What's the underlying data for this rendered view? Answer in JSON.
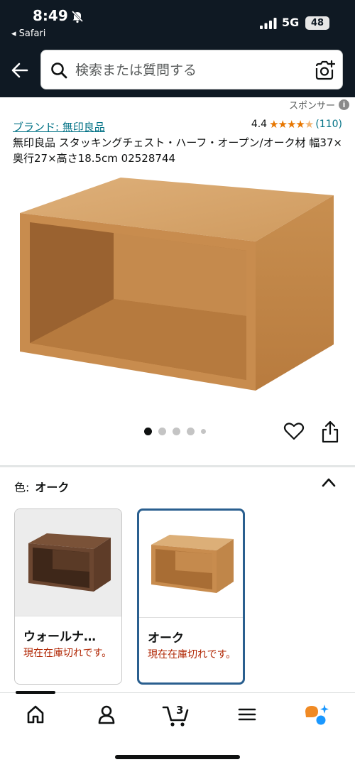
{
  "status_bar": {
    "time": "8:49",
    "back_app": "◂ Safari",
    "network": "5G",
    "battery": "48"
  },
  "header": {
    "search_placeholder": "検索または質問する"
  },
  "sponsored": "スポンサー",
  "product": {
    "brand_link": "ブランド: 無印良品",
    "rating": "4.4",
    "rating_value": 4.4,
    "review_count": "(110)",
    "title": "無印良品 スタッキングチェスト・ハーフ・オープン/オーク材 幅37×奥行27×高さ18.5cm 02528744"
  },
  "gallery": {
    "image_count": 5,
    "active_index": 0
  },
  "variants": {
    "label": "色:",
    "selected": "オーク",
    "options": [
      {
        "name": "ウォールナ…",
        "stock": "現在在庫切れです。",
        "finish": "walnut"
      },
      {
        "name": "オーク",
        "stock": "現在在庫切れです。",
        "finish": "oak"
      }
    ]
  },
  "tabbar": {
    "cart_count": "3"
  },
  "colors": {
    "header_bg": "#0f1923",
    "link": "#007185",
    "star": "#e77600",
    "out_of_stock": "#b12704",
    "selected_border": "#2a5f8f",
    "alexa_orange": "#f08a24",
    "alexa_blue": "#1a98ff"
  }
}
